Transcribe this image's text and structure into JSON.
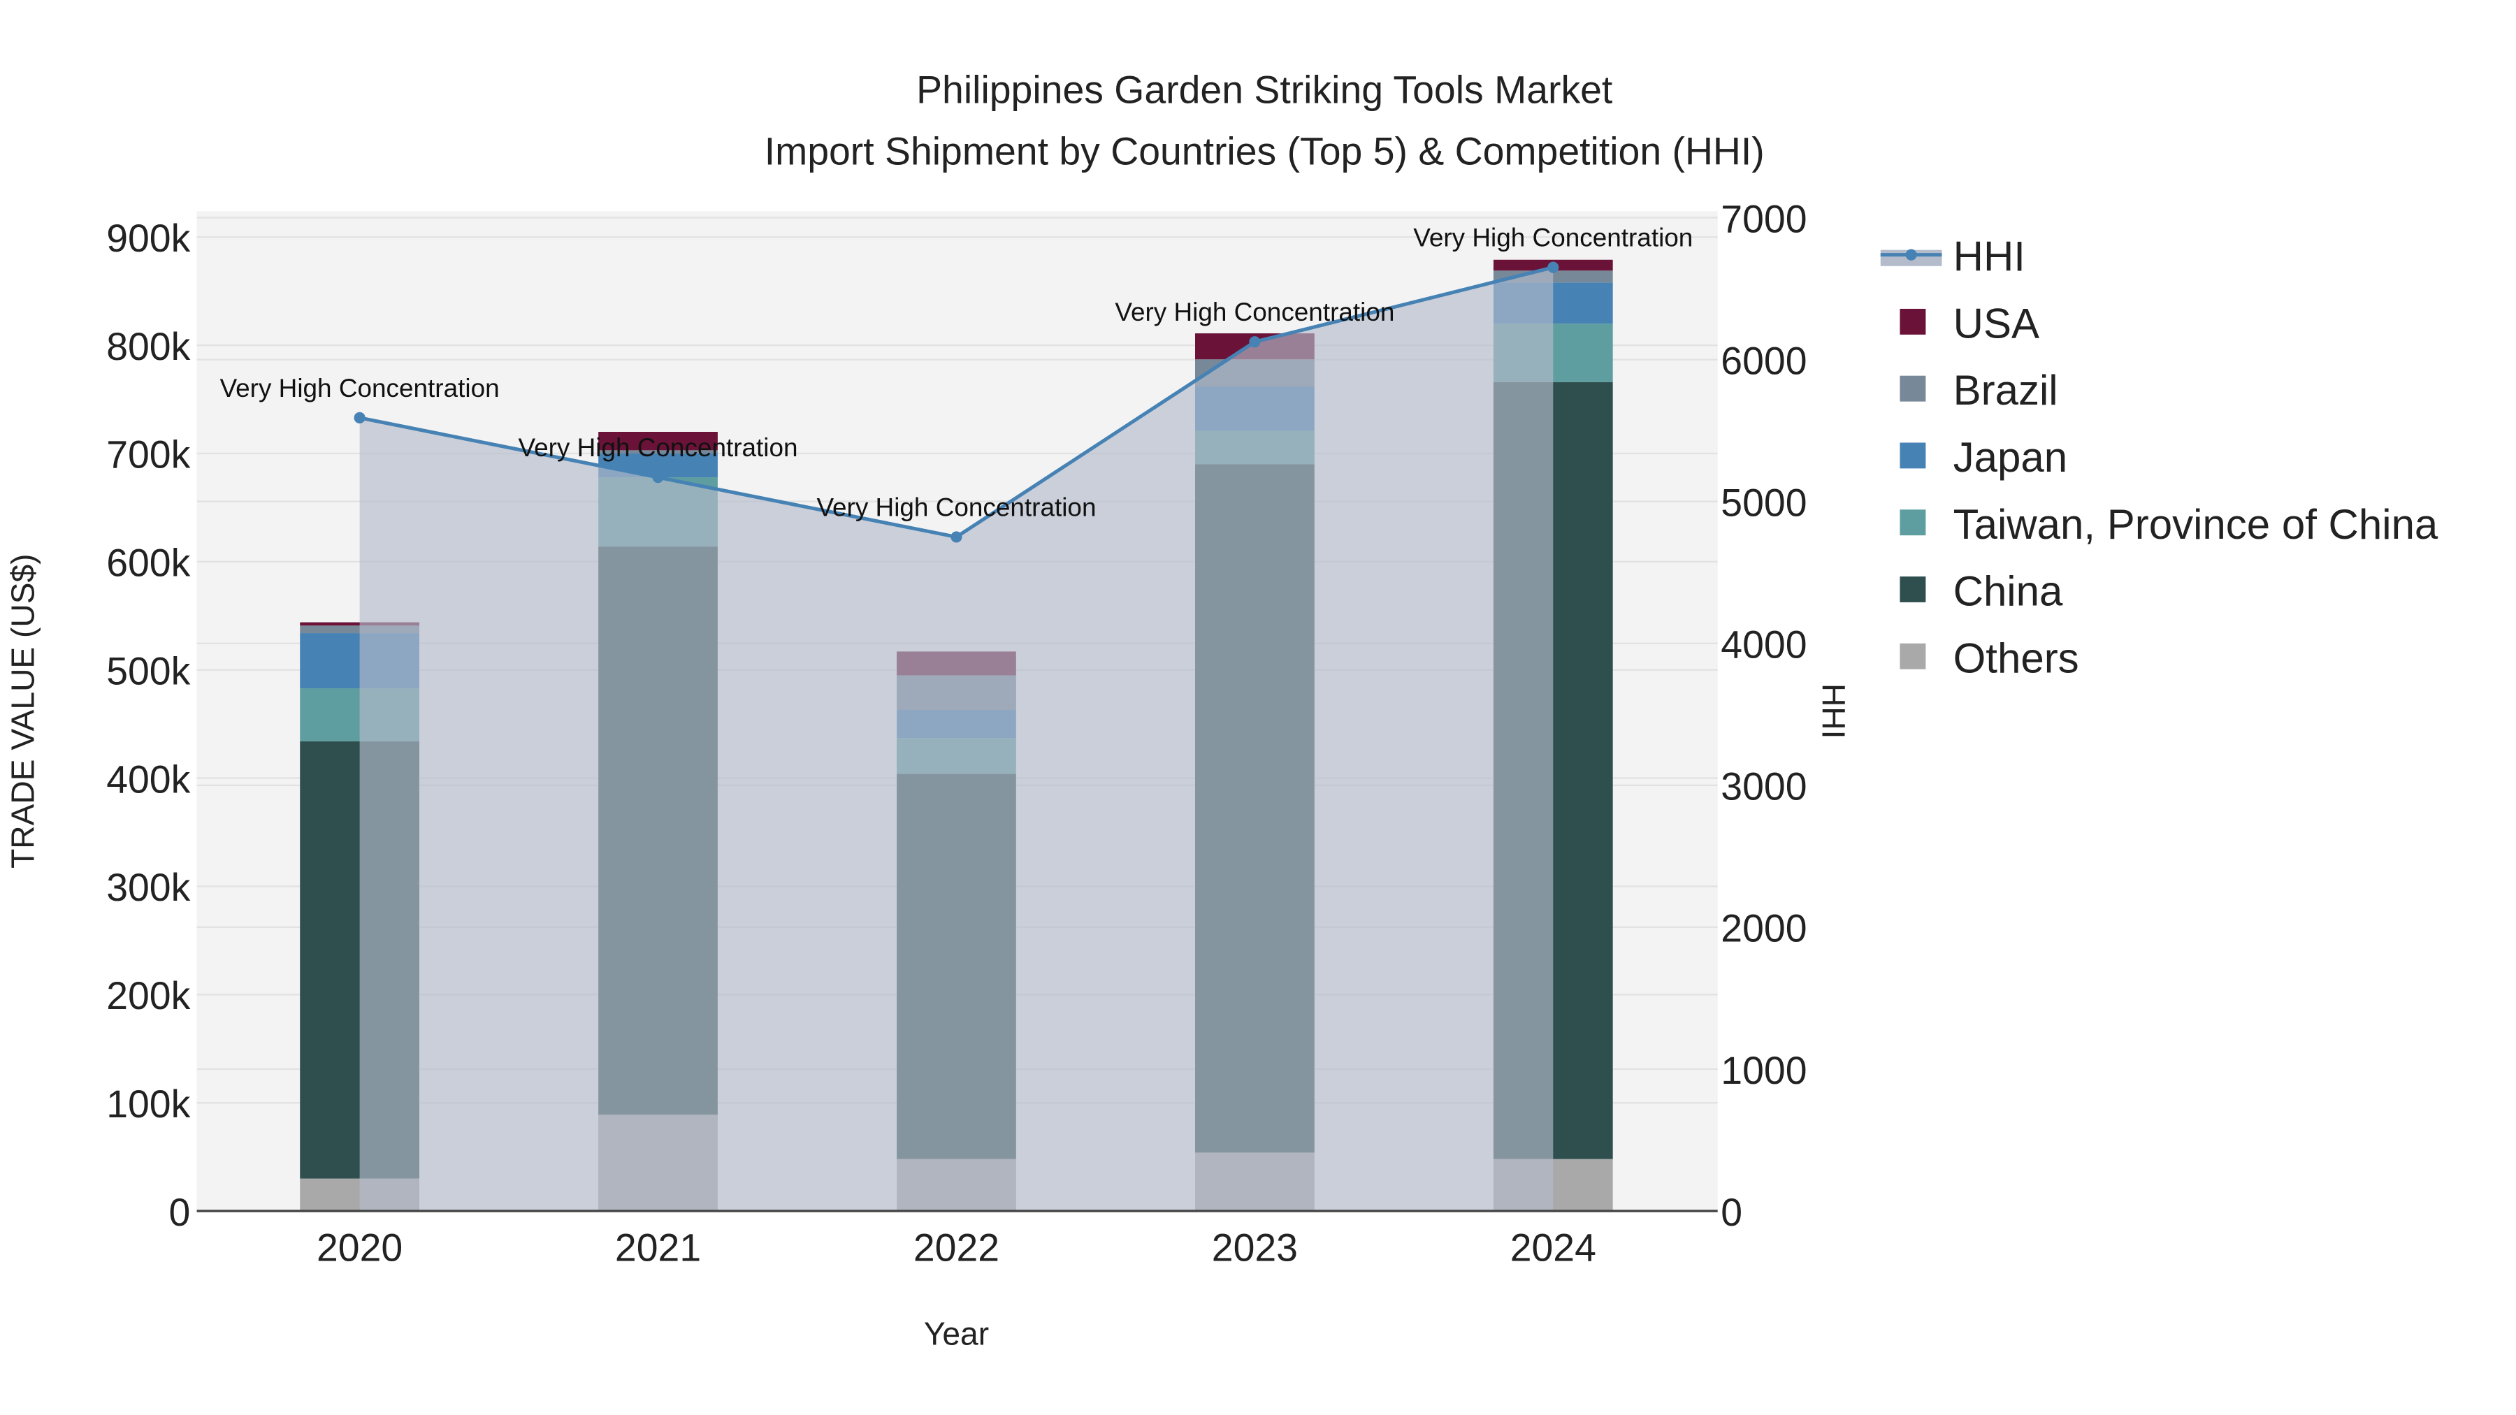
{
  "chart_data": {
    "type": "bar",
    "title_line1": "Philippines Garden Striking Tools Market",
    "title_line2": "Import Shipment by Countries (Top 5) & Competition (HHI)",
    "xlabel": "Year",
    "ylabel": "TRADE VALUE (US$)",
    "y2label": "HHI",
    "categories": [
      "2020",
      "2021",
      "2022",
      "2023",
      "2024"
    ],
    "ylim": [
      0,
      920000
    ],
    "y_ticks": [
      0,
      100000,
      200000,
      300000,
      400000,
      500000,
      600000,
      700000,
      800000,
      900000
    ],
    "y_tick_labels": [
      "0",
      "100k",
      "200k",
      "300k",
      "400k",
      "500k",
      "600k",
      "700k",
      "800k",
      "900k"
    ],
    "y2lim": [
      0,
      7050
    ],
    "y2_ticks": [
      0,
      1000,
      2000,
      3000,
      4000,
      5000,
      6000,
      7000
    ],
    "y2_tick_labels": [
      "0",
      "1000",
      "2000",
      "3000",
      "4000",
      "5000",
      "6000",
      "7000"
    ],
    "grid": true,
    "legend_position": "right",
    "series": [
      {
        "name": "Others",
        "color": "#a9a9a9",
        "values": [
          30000,
          89000,
          48000,
          54000,
          48000
        ]
      },
      {
        "name": "China",
        "color": "#2f4f4f",
        "values": [
          404000,
          525000,
          356000,
          636000,
          718000
        ]
      },
      {
        "name": "Taiwan, Province of China",
        "color": "#5f9ea0",
        "values": [
          49000,
          64000,
          33000,
          31000,
          54000
        ]
      },
      {
        "name": "Japan",
        "color": "#4682b4",
        "values": [
          51000,
          22000,
          26000,
          41000,
          38000
        ]
      },
      {
        "name": "Brazil",
        "color": "#778899",
        "values": [
          7000,
          3000,
          32000,
          25000,
          11000
        ]
      },
      {
        "name": "USA",
        "color": "#6b1238",
        "values": [
          3000,
          17000,
          22000,
          24000,
          10000
        ]
      }
    ],
    "hhi": {
      "name": "HHI",
      "color": "#4682b4",
      "fill": "#b4bccb",
      "values": [
        5590,
        5170,
        4750,
        6125,
        6650
      ],
      "annotations": [
        "Very High Concentration",
        "Very High Concentration",
        "Very High Concentration",
        "Very High Concentration",
        "Very High Concentration"
      ]
    },
    "legend_order": [
      "HHI",
      "USA",
      "Brazil",
      "Japan",
      "Taiwan, Province of China",
      "China",
      "Others"
    ]
  }
}
